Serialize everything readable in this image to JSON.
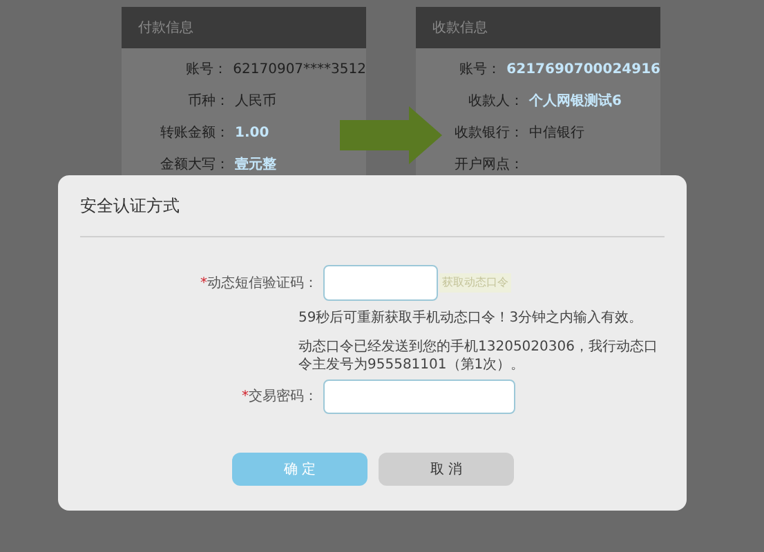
{
  "payer_panel": {
    "title": "付款信息",
    "rows": [
      {
        "label": "账号：",
        "value": "62170907****3512",
        "highlight": false
      },
      {
        "label": "币种：",
        "value": "人民币",
        "highlight": false
      },
      {
        "label": "转账金额：",
        "value": "1.00",
        "highlight": true
      },
      {
        "label": "金额大写：",
        "value": "壹元整",
        "highlight": true
      }
    ]
  },
  "payee_panel": {
    "title": "收款信息",
    "rows": [
      {
        "label": "账号：",
        "value": "6217690700024916",
        "highlight": true
      },
      {
        "label": "收款人：",
        "value": "个人网银测试6",
        "highlight": true
      },
      {
        "label": "收款银行：",
        "value": "中信银行",
        "highlight": false
      },
      {
        "label": "开户网点："
      }
    ]
  },
  "dialog": {
    "title": "安全认证方式",
    "sms_field": {
      "required_mark": "*",
      "label": "动态短信验证码：",
      "get_code_button": "获取动态口令"
    },
    "hints": [
      "59秒后可重新获取手机动态口令！3分钟之内输入有效。",
      "动态口令已经发送到您的手机13205020306，我行动态口令主发号为955581101（第1次）。"
    ],
    "password_field": {
      "required_mark": "*",
      "label": "交易密码："
    },
    "buttons": [
      {
        "label": "确 定",
        "kind": "primary"
      },
      {
        "label": "取 消",
        "kind": "secondary"
      }
    ]
  }
}
